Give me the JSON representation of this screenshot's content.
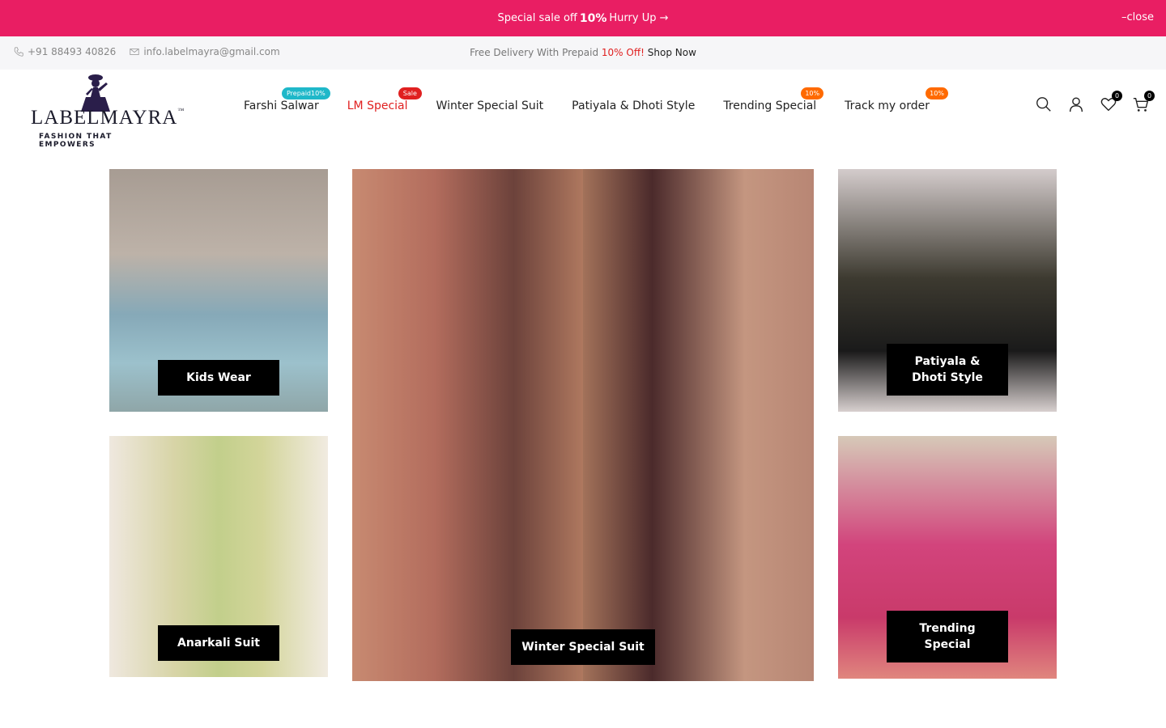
{
  "promo": {
    "text_before": "Special sale off",
    "highlight": "10%",
    "text_after": "Hurry Up →",
    "close_label": "close",
    "color": "#e91e63"
  },
  "infobar": {
    "phone": "+91 88493 40826",
    "email": "info.labelmayra@gmail.com",
    "delivery_text": "Free Delivery With Prepaid",
    "delivery_offer": "10% Off!",
    "shop_now": "Shop Now"
  },
  "logo": {
    "brand": "LABELMAYRA",
    "tagline": "FASHION THAT EMPOWERS"
  },
  "nav": [
    {
      "label": "Farshi Salwar",
      "badge": "Prepaid10%"
    },
    {
      "label": "LM Special",
      "badge": "Sale"
    },
    {
      "label": "Winter Special Suit",
      "badge": ""
    },
    {
      "label": "Patiyala & Dhoti Style",
      "badge": ""
    },
    {
      "label": "Trending Special",
      "badge": "10%"
    },
    {
      "label": "Track my order",
      "badge": "10%"
    }
  ],
  "header_icons": {
    "wishlist_count": "0",
    "cart_count": "0"
  },
  "categories": {
    "kids": "Kids Wear",
    "anarkali": "Anarkali Suit",
    "winter": "Winter Special Suit",
    "patiyala": "Patiyala & Dhoti Style",
    "trending": "Trending Special"
  },
  "colors": {
    "accent": "#e91e63",
    "badge_teal": "#1fb8c9",
    "badge_red": "#e02020",
    "badge_orange": "#ff6a00"
  }
}
